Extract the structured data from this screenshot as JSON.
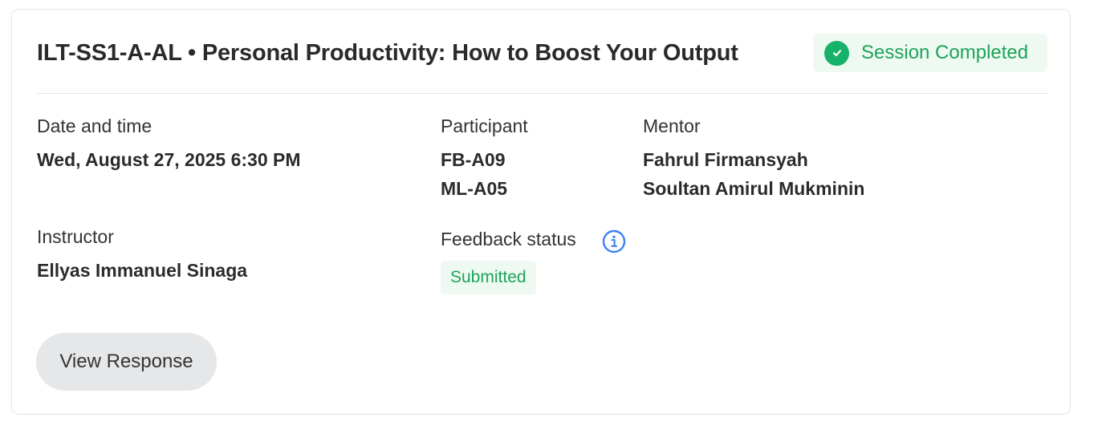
{
  "session": {
    "title": "ILT-SS1-A-AL • Personal Productivity: How to Boost Your Output",
    "status_label": "Session Completed",
    "status_icon": "check-circle-icon"
  },
  "details": {
    "date_label": "Date and time",
    "date_value": "Wed, August 27, 2025 6:30 PM",
    "participant_label": "Participant",
    "participants": [
      "FB-A09",
      "ML-A05"
    ],
    "mentor_label": "Mentor",
    "mentors": [
      "Fahrul Firmansyah",
      "Soultan Amirul Mukminin"
    ],
    "instructor_label": "Instructor",
    "instructor_value": "Ellyas Immanuel Sinaga",
    "feedback_label": "Feedback status",
    "feedback_info_icon": "info-icon",
    "feedback_value": "Submitted"
  },
  "actions": {
    "view_response_label": "View Response"
  },
  "colors": {
    "success_green": "#16b26a",
    "success_text": "#1ea35a",
    "success_bg": "#eefaf1",
    "info_blue": "#3b82f6",
    "button_bg": "#e6e7e9"
  }
}
